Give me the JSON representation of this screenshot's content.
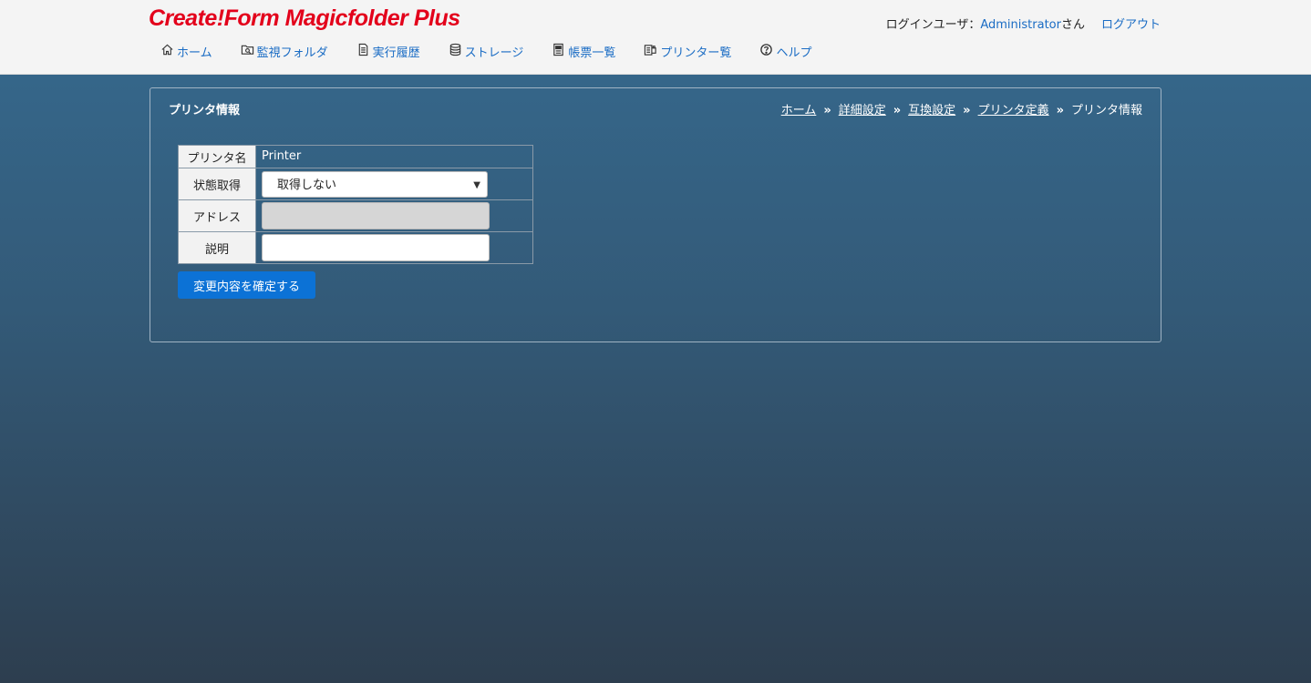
{
  "header": {
    "logo": "Create!Form Magicfolder Plus",
    "login_label": "ログインユーザ：",
    "user_name": "Administrator",
    "user_suffix": "さん",
    "logout": "ログアウト"
  },
  "nav": {
    "items": [
      {
        "label": "ホーム",
        "icon": "home-icon"
      },
      {
        "label": "監視フォルダ",
        "icon": "folder-search-icon"
      },
      {
        "label": "実行履歴",
        "icon": "document-icon"
      },
      {
        "label": "ストレージ",
        "icon": "database-icon"
      },
      {
        "label": "帳票一覧",
        "icon": "form-list-icon"
      },
      {
        "label": "プリンター覧",
        "icon": "printer-list-icon"
      },
      {
        "label": "ヘルプ",
        "icon": "help-icon"
      }
    ]
  },
  "panel": {
    "title": "プリンタ情報",
    "breadcrumb": [
      "ホーム",
      "詳細設定",
      "互換設定",
      "プリンタ定義"
    ],
    "breadcrumb_current": "プリンタ情報"
  },
  "form": {
    "printer_name_label": "プリンタ名",
    "printer_name_value": "Printer",
    "status_label": "状態取得",
    "status_value": "取得しない",
    "address_label": "アドレス",
    "address_value": "",
    "description_label": "説明",
    "description_value": "",
    "submit_label": "変更内容を確定する"
  },
  "colors": {
    "accent": "#1a6cc4",
    "logo": "#e3001b",
    "button": "#0c72d6"
  }
}
